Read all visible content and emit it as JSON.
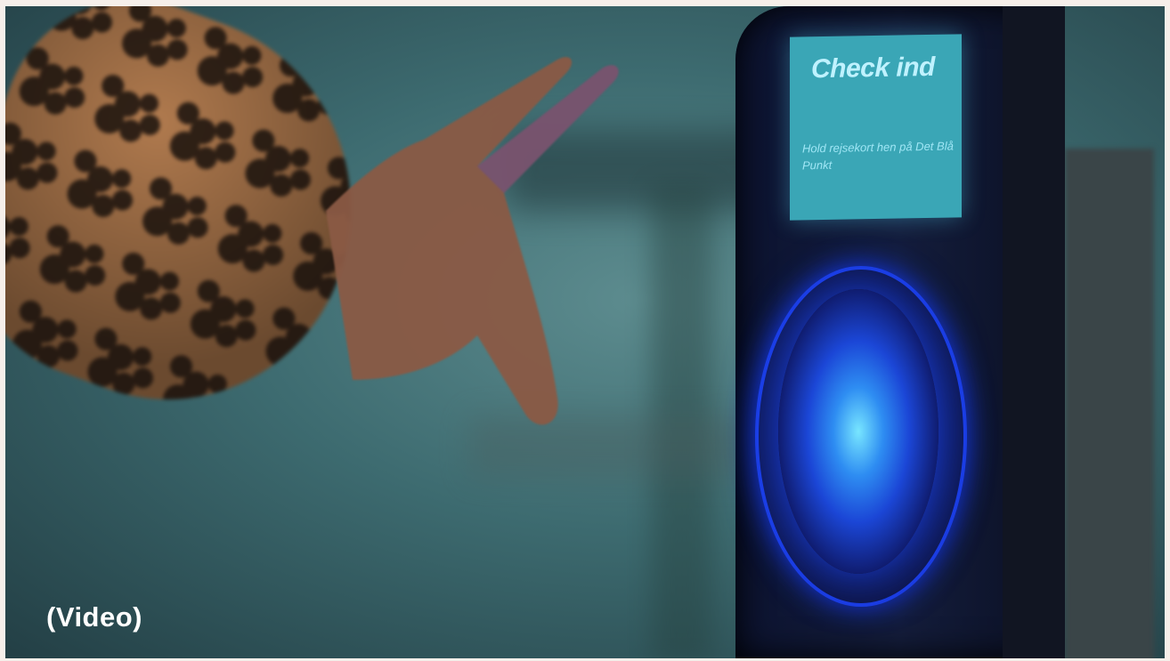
{
  "video": {
    "caption": "(Video)",
    "scene": {
      "screen_title": "Check ind",
      "screen_subtitle": "Hold rejsekort hen på Det Blå Punkt"
    }
  },
  "colors": {
    "frame": "#f6efea",
    "screen": "#3aa6b6",
    "glow_center": "#78e6ff",
    "glow_ring": "#1b3ce0",
    "caption_text": "#ffffff"
  }
}
